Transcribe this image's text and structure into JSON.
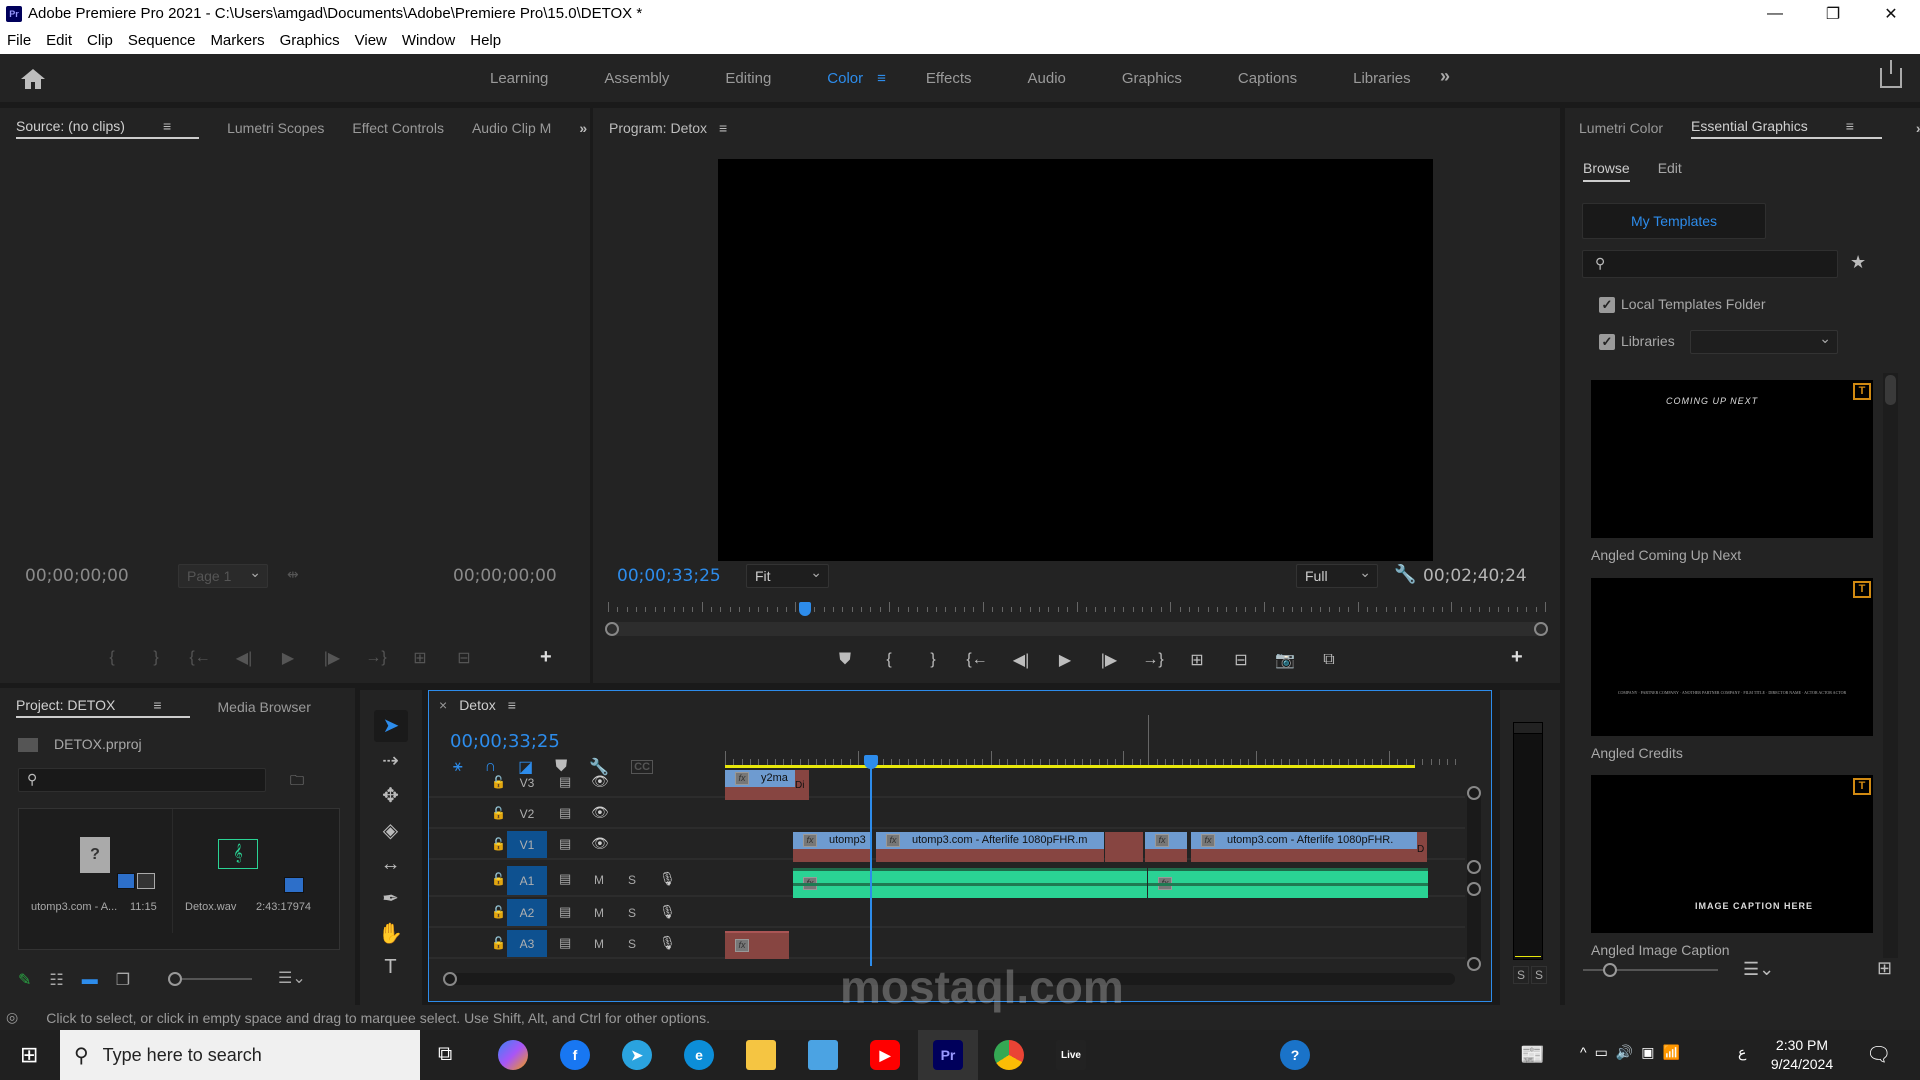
{
  "window": {
    "app_badge": "Pr",
    "title": "Adobe Premiere Pro 2021 - C:\\Users\\amgad\\Documents\\Adobe\\Premiere Pro\\15.0\\DETOX *",
    "minimize": "—",
    "restore": "❐",
    "close": "✕"
  },
  "menu": [
    "File",
    "Edit",
    "Clip",
    "Sequence",
    "Markers",
    "Graphics",
    "View",
    "Window",
    "Help"
  ],
  "workspaces": {
    "tabs": [
      "Learning",
      "Assembly",
      "Editing",
      "Color",
      "Effects",
      "Audio",
      "Graphics",
      "Captions",
      "Libraries"
    ],
    "active": "Color",
    "more": "»",
    "menu_icon": "≡"
  },
  "source_panel": {
    "tabs": [
      "Source: (no clips)",
      "Lumetri Scopes",
      "Effect Controls",
      "Audio Clip M"
    ],
    "menu_icon": "≡",
    "more": "»",
    "timecode_in": "00;00;00;00",
    "page": "Page 1",
    "timecode_out": "00;00;00;00",
    "controls": [
      "{",
      "}",
      "{←",
      "◀|",
      "▶",
      "|▶",
      "→}",
      "⊞",
      "⊟"
    ],
    "add": "+"
  },
  "program_panel": {
    "title": "Program: Detox",
    "menu_icon": "≡",
    "timecode": "00;00;33;25",
    "zoom": "Fit",
    "quality": "Full",
    "duration": "00;02;40;24",
    "playhead_fraction": 0.21,
    "controls": [
      "⛊",
      "{",
      "}",
      "{←",
      "◀|",
      "▶",
      "|▶",
      "→}",
      "⊞",
      "⊟",
      "📷",
      "⧉"
    ],
    "add": "+"
  },
  "essential_graphics": {
    "tabs": [
      "Lumetri Color",
      "Essential Graphics"
    ],
    "active_tab": "Essential Graphics",
    "menu_icon": "≡",
    "more": "»",
    "subtabs": [
      "Browse",
      "Edit"
    ],
    "active_subtab": "Browse",
    "my_templates": "My Templates",
    "search_placeholder": "",
    "favorite_icon": "★",
    "local_templates_label": "Local Templates Folder",
    "local_templates_checked": true,
    "libraries_label": "Libraries",
    "libraries_checked": true,
    "libraries_value": "",
    "templates": [
      {
        "name": "Angled Coming Up Next",
        "preview_text": "COMING UP NEXT"
      },
      {
        "name": "Angled Credits",
        "preview_text": "COMPANY · PARTNER COMPANY · ANOTHER PARTNER COMPANY · FILM TITLE · DIRECTOR NAME · ACTOR ACTOR ACTOR"
      },
      {
        "name": "Angled Image Caption",
        "preview_text": "IMAGE CAPTION HERE"
      }
    ],
    "badge_text": "T"
  },
  "project_panel": {
    "tabs": [
      "Project: DETOX",
      "Media Browser"
    ],
    "menu_icon": "≡",
    "more": "»",
    "project_file": "DETOX.prproj",
    "search_placeholder": "",
    "items": [
      {
        "name": "utomp3.com - A...",
        "duration": "11:15",
        "type": "missing-video"
      },
      {
        "name": "Detox.wav",
        "duration": "2:43:17974",
        "type": "audio"
      }
    ]
  },
  "tools": [
    "selection",
    "track-select-forward",
    "ripple-edit",
    "razor",
    "slip",
    "pen",
    "hand",
    "type"
  ],
  "timeline": {
    "sequence_name": "Detox",
    "close": "×",
    "menu_icon": "≡",
    "timecode": "00;00;33;25",
    "tracks": [
      {
        "id": "V3",
        "kind": "video",
        "targeted": false
      },
      {
        "id": "V2",
        "kind": "video",
        "targeted": false
      },
      {
        "id": "V1",
        "kind": "video",
        "targeted": true
      },
      {
        "id": "A1",
        "kind": "audio",
        "targeted": true
      },
      {
        "id": "A2",
        "kind": "audio",
        "targeted": true
      },
      {
        "id": "A3",
        "kind": "audio",
        "targeted": true
      }
    ],
    "mute_label": "M",
    "solo_label": "S",
    "clips": {
      "v3": "y2ma",
      "v3_transition": "Di",
      "v1_a": "utomp3",
      "v1_b": "utomp3.com - Afterlife  1080pFHR.m",
      "v1_c": "utomp3.com - Afterlife  1080pFHR.",
      "v1_transition": "D"
    },
    "fx_label": "fx",
    "playhead_fraction": 0.21
  },
  "audio_meter": {
    "solo_left": "S",
    "solo_right": "S"
  },
  "status_bar": {
    "message": "Click to select, or click in empty space and drag to marquee select. Use Shift, Alt, and Ctrl for other options."
  },
  "taskbar": {
    "search_placeholder": "Type here to search",
    "live_label": "Live",
    "pr_label": "Pr",
    "time": "2:30 PM",
    "date": "9/24/2024",
    "lang": "ع"
  },
  "watermark": "mostaql.com"
}
